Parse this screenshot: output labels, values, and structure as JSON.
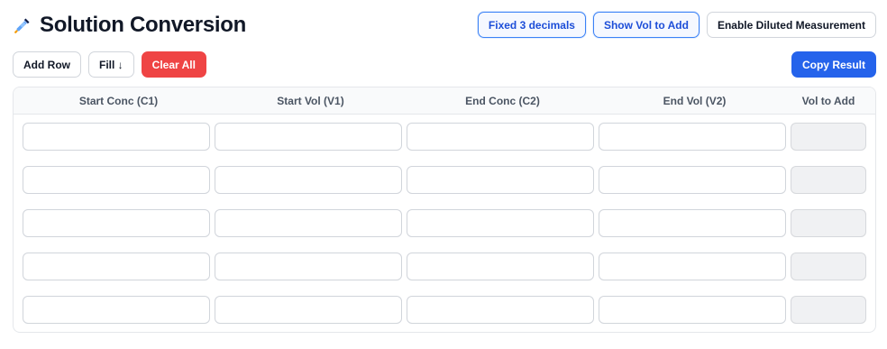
{
  "header": {
    "icon": "dropper-icon",
    "title": "Solution Conversion",
    "toggles": [
      {
        "label": "Fixed 3 decimals",
        "active": true
      },
      {
        "label": "Show Vol to Add",
        "active": true
      },
      {
        "label": "Enable Diluted Measurement",
        "active": false
      }
    ]
  },
  "toolbar": {
    "add_row_label": "Add Row",
    "fill_label": "Fill ↓",
    "clear_all_label": "Clear All",
    "copy_result_label": "Copy Result"
  },
  "table": {
    "columns": [
      "Start Conc (C1)",
      "Start Vol (V1)",
      "End Conc (C2)",
      "End Vol (V2)",
      "Vol to Add"
    ],
    "rows": [
      [
        "",
        "",
        "",
        "",
        ""
      ],
      [
        "",
        "",
        "",
        "",
        ""
      ],
      [
        "",
        "",
        "",
        "",
        ""
      ],
      [
        "",
        "",
        "",
        "",
        ""
      ],
      [
        "",
        "",
        "",
        "",
        ""
      ]
    ]
  },
  "colors": {
    "accent_blue": "#2563eb",
    "danger_red": "#ef4444",
    "toggle_border": "#3b82f6"
  }
}
